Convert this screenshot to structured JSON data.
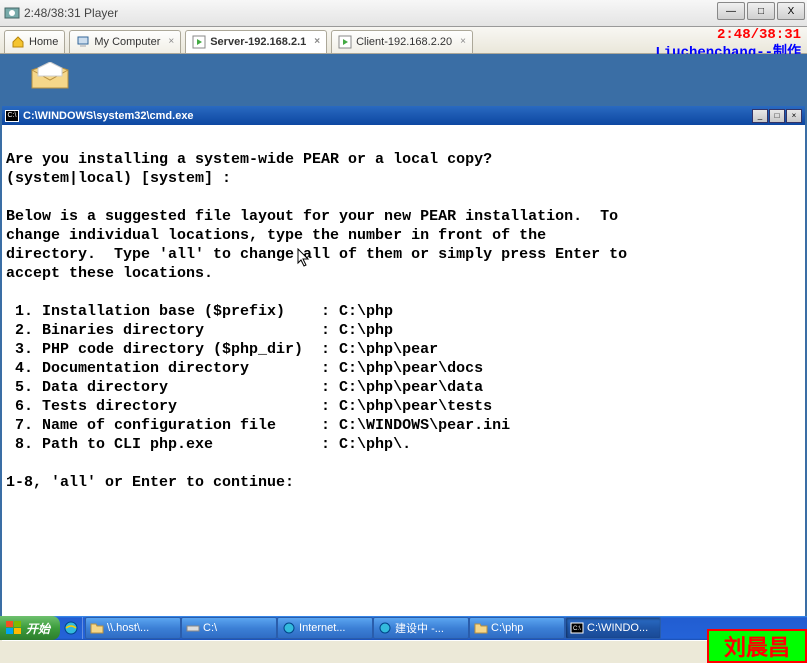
{
  "player": {
    "title": "2:48/38:31 Player"
  },
  "windowControls": {
    "min": "—",
    "max": "□",
    "close": "X"
  },
  "tabs": [
    {
      "label": "Home",
      "active": false,
      "icon": "home"
    },
    {
      "label": "My Computer",
      "active": false,
      "icon": "computer"
    },
    {
      "label": "Server-192.168.2.1",
      "active": true,
      "icon": "vm-on"
    },
    {
      "label": "Client-192.168.2.20",
      "active": false,
      "icon": "vm-on"
    }
  ],
  "overlay": {
    "time": "2:48/38:31",
    "credit": "Liuchenchang--制作"
  },
  "cmd": {
    "title": "C:\\WINDOWS\\system32\\cmd.exe",
    "body": "\nAre you installing a system-wide PEAR or a local copy?\n(system|local) [system] :\n\nBelow is a suggested file layout for your new PEAR installation.  To\nchange individual locations, type the number in front of the\ndirectory.  Type 'all' to change all of them or simply press Enter to\naccept these locations.\n\n 1. Installation base ($prefix)    : C:\\php\n 2. Binaries directory             : C:\\php\n 3. PHP code directory ($php_dir)  : C:\\php\\pear\n 4. Documentation directory        : C:\\php\\pear\\docs\n 5. Data directory                 : C:\\php\\pear\\data\n 6. Tests directory                : C:\\php\\pear\\tests\n 7. Name of configuration file     : C:\\WINDOWS\\pear.ini\n 8. Path to CLI php.exe            : C:\\php\\.\n\n1-8, 'all' or Enter to continue:"
  },
  "taskbar": {
    "start": "开始",
    "buttons": [
      {
        "label": "\\\\.host\\...",
        "active": false
      },
      {
        "label": "C:\\",
        "active": false
      },
      {
        "label": "Internet...",
        "active": false
      },
      {
        "label": "建设中 -...",
        "active": false
      },
      {
        "label": "C:\\php",
        "active": false
      },
      {
        "label": "C:\\WINDO...",
        "active": true
      }
    ]
  },
  "watermark": "刘晨昌"
}
